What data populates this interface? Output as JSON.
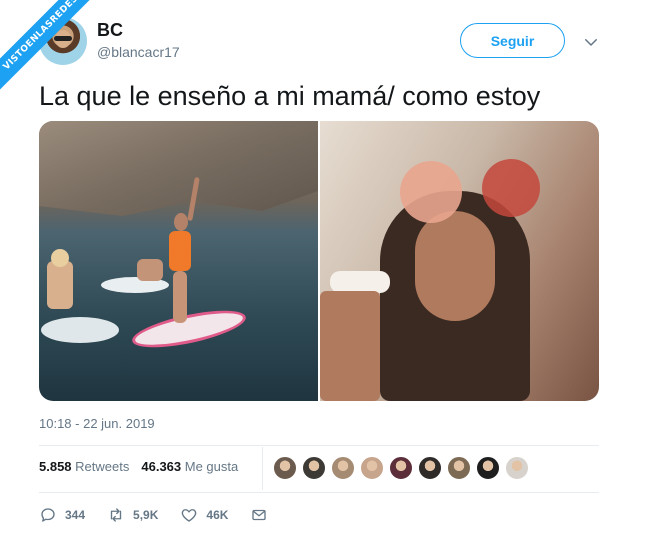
{
  "watermark": "VISTOENLASREDES",
  "tweet": {
    "author_name": "BC",
    "author_handle": "@blancacr17",
    "follow_label": "Seguir",
    "text": "La que le enseño a mi mamá/ como estoy",
    "timestamp": "10:18 - 22 jun. 2019"
  },
  "stats": {
    "retweets_count": "5.858",
    "retweets_label": "Retweets",
    "likes_count": "46.363",
    "likes_label": "Me gusta"
  },
  "likers": [
    "#6b5a4e",
    "#3d3a36",
    "#a58b72",
    "#c7a48c",
    "#5b2e3a",
    "#2e2b29",
    "#7c6a55",
    "#1e1e1e",
    "#d8d2cc"
  ],
  "actions": {
    "reply_count": "344",
    "retweet_count": "5,9K",
    "like_count": "46K"
  },
  "colors": {
    "accent": "#1da1f2",
    "text_primary": "#14171a",
    "text_secondary": "#657786"
  }
}
